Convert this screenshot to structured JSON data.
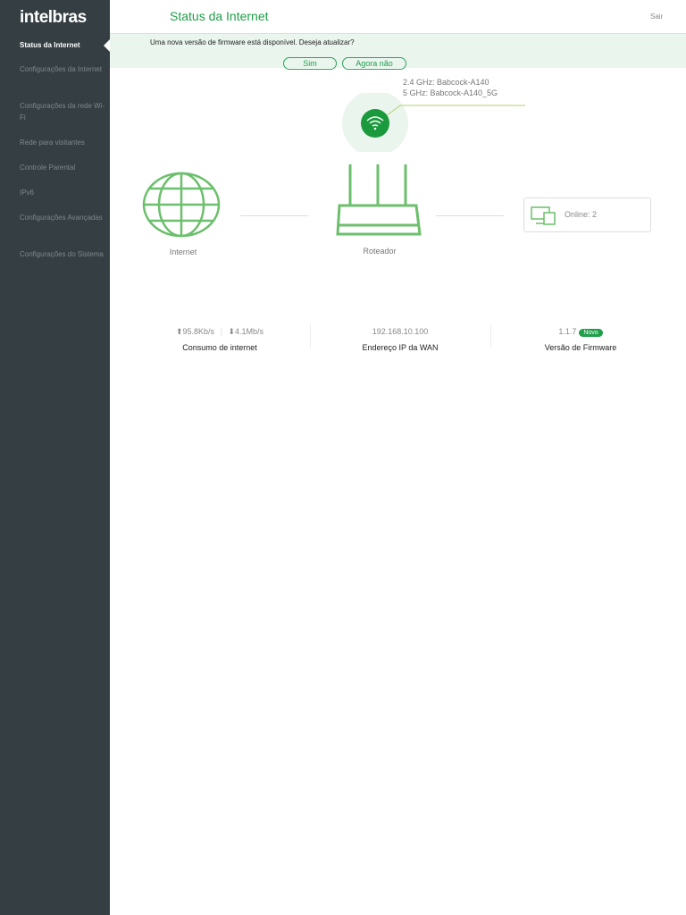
{
  "brand": "intelbras",
  "header": {
    "title": "Status da Internet",
    "logout": "Sair"
  },
  "sidebar": {
    "items": [
      {
        "label": "Status da Internet"
      },
      {
        "label": "Configurações da Internet"
      },
      {
        "label": "Configurações da rede Wi-Fi"
      },
      {
        "label": "Rede para visitantes"
      },
      {
        "label": "Controle Parental"
      },
      {
        "label": "IPv6"
      },
      {
        "label": "Configurações Avançadas"
      },
      {
        "label": "Configurações do Sistema"
      }
    ]
  },
  "banner": {
    "message": "Uma nova versão de firmware está disponível. Deseja atualizar?",
    "yes": "Sim",
    "no": "Agora não"
  },
  "wifi": {
    "ssid_24": "2.4 GHz: Babcock-A140",
    "ssid_5": "5 GHz: Babcock-A140_5G"
  },
  "topology": {
    "internet": "Internet",
    "router": "Roteador",
    "online": "Online:  2"
  },
  "stats": {
    "upload": "95.8Kb/s",
    "download": "4.1Mb/s",
    "usage_label": "Consumo de internet",
    "wan_ip": "192.168.10.100",
    "wan_label": "Endereço IP da WAN",
    "fw_version": "1.1.7",
    "fw_badge": "Novo",
    "fw_label": "Versão de Firmware"
  },
  "colors": {
    "accent": "#1fa04a",
    "sidebar": "#353f43",
    "icon": "#6cbf6c"
  }
}
